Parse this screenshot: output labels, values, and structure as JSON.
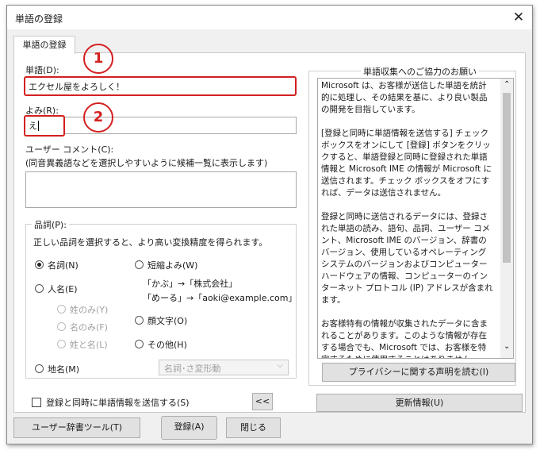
{
  "window": {
    "title": "単語の登録",
    "close_symbol": "✕"
  },
  "tab": {
    "label": "単語の登録"
  },
  "word": {
    "label": "単語(D):",
    "value": "エクセル屋をよろしく！"
  },
  "yomi": {
    "label": "よみ(R):",
    "value": "え"
  },
  "comment": {
    "label": "ユーザー コメント(C):",
    "hint": "(同音異義語などを選択しやすいように候補一覧に表示します)",
    "value": ""
  },
  "pos": {
    "legend": "品詞(P):",
    "description": "正しい品詞を選択すると、より高い変換精度を得られます。",
    "options": {
      "noun": "名詞(N)",
      "person": "人名(E)",
      "surname_only": "姓のみ(Y)",
      "given_only": "名のみ(F)",
      "full_name": "姓と名(L)",
      "place": "地名(M)",
      "short_reading": "短縮よみ(W)",
      "emoticon": "顔文字(O)",
      "other": "その他(H)"
    },
    "selected": "noun",
    "short_examples": [
      "「かぶ」→「株式会社」",
      "「めーる」→「aoki@example.com」"
    ],
    "other_select_value": "名詞･さ変形動"
  },
  "send_checkbox": {
    "label": "登録と同時に単語情報を送信する(S)",
    "checked": false
  },
  "collapse_button": {
    "label": "<<"
  },
  "info": {
    "legend": "単語収集へのご協力のお願い",
    "paragraphs": [
      "Microsoft は、お客様が送信した単語を統計的に処理し、その結果を基に、より良い製品の開発を目指しています。",
      "[登録と同時に単語情報を送信する] チェック ボックスをオンにして [登録] ボタンをクリックすると、単語登録と同時に登録された単語情報と Microsoft IME の情報が Microsoft に送信されます。チェック ボックスをオフにすれば、データは送信されません。",
      "登録と同時に送信されるデータには、登録された単語の読み、語句、品詞、ユーザー コメント、Microsoft IME のバージョン、辞書のバージョン、使用しているオペレーティング システムのバージョンおよびコンピューター ハードウェアの情報、コンピューターのインターネット プロトコル (IP) アドレスが含まれます。",
      "お客様特有の情報が収集されたデータに含まれることがあります。このような情報が存在する場合でも、Microsoft では、お客様を特定するために使用することはありません。"
    ],
    "privacy_button": "プライバシーに関する声明を読む(I)",
    "update_button": "更新情報(U)"
  },
  "footer": {
    "dict_tool_button": "ユーザー辞書ツール(T)",
    "register_button": "登録(A)",
    "close_button": "閉じる"
  },
  "callouts": {
    "first": "1",
    "second": "2"
  },
  "colors": {
    "callout": "#d42020"
  }
}
